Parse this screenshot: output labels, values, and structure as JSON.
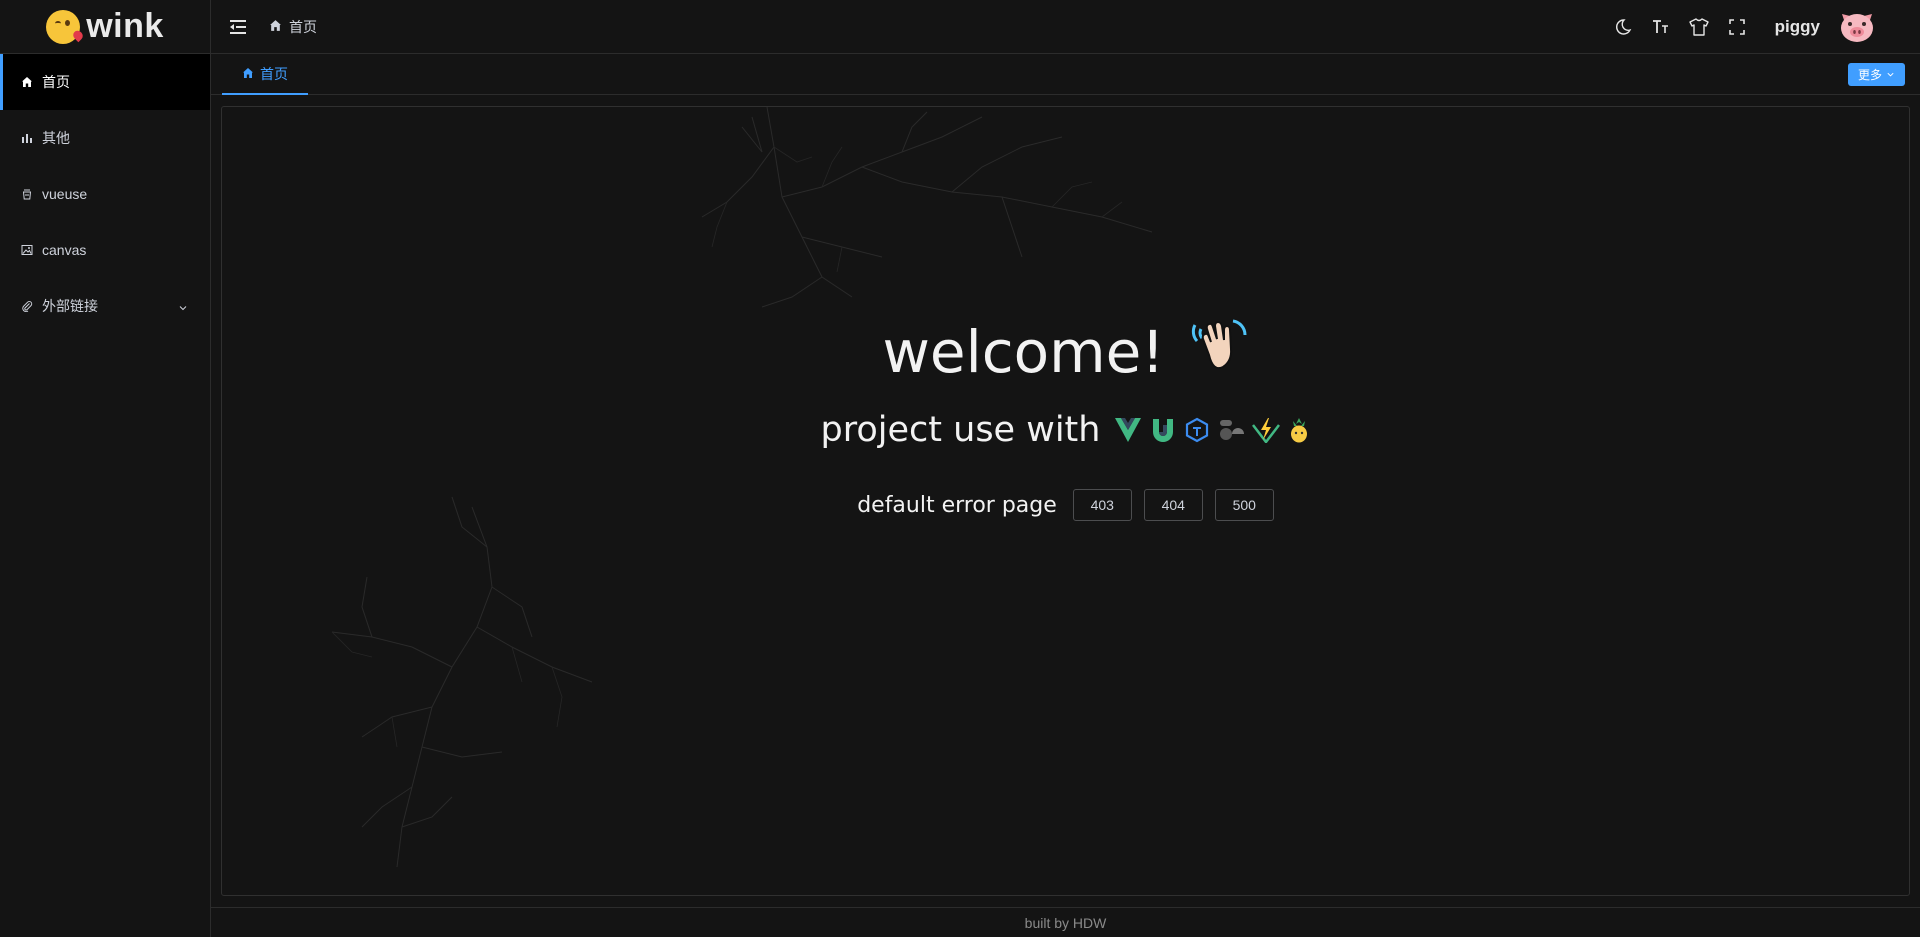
{
  "app": {
    "logo_text": "wink"
  },
  "sidebar": {
    "items": [
      {
        "label": "首页",
        "icon": "home-icon",
        "active": true
      },
      {
        "label": "其他",
        "icon": "bar-chart-icon",
        "active": false
      },
      {
        "label": "vueuse",
        "icon": "cup-icon",
        "active": false
      },
      {
        "label": "canvas",
        "icon": "image-icon",
        "active": false
      },
      {
        "label": "外部链接",
        "icon": "paperclip-icon",
        "active": false,
        "has_submenu": true
      }
    ]
  },
  "header": {
    "breadcrumb": "首页",
    "username": "piggy",
    "icons": [
      "moon-icon",
      "font-size-icon",
      "tshirt-icon",
      "fullscreen-icon"
    ]
  },
  "tabs": {
    "items": [
      {
        "label": "首页",
        "active": true
      }
    ],
    "more_label": "更多"
  },
  "main": {
    "welcome": "welcome!",
    "project_text": "project use with",
    "error_label": "default error page",
    "error_buttons": [
      "403",
      "404",
      "500"
    ]
  },
  "footer": {
    "text": "built by HDW"
  },
  "colors": {
    "accent": "#409eff",
    "background": "#141414",
    "border": "#2c2c2c"
  }
}
